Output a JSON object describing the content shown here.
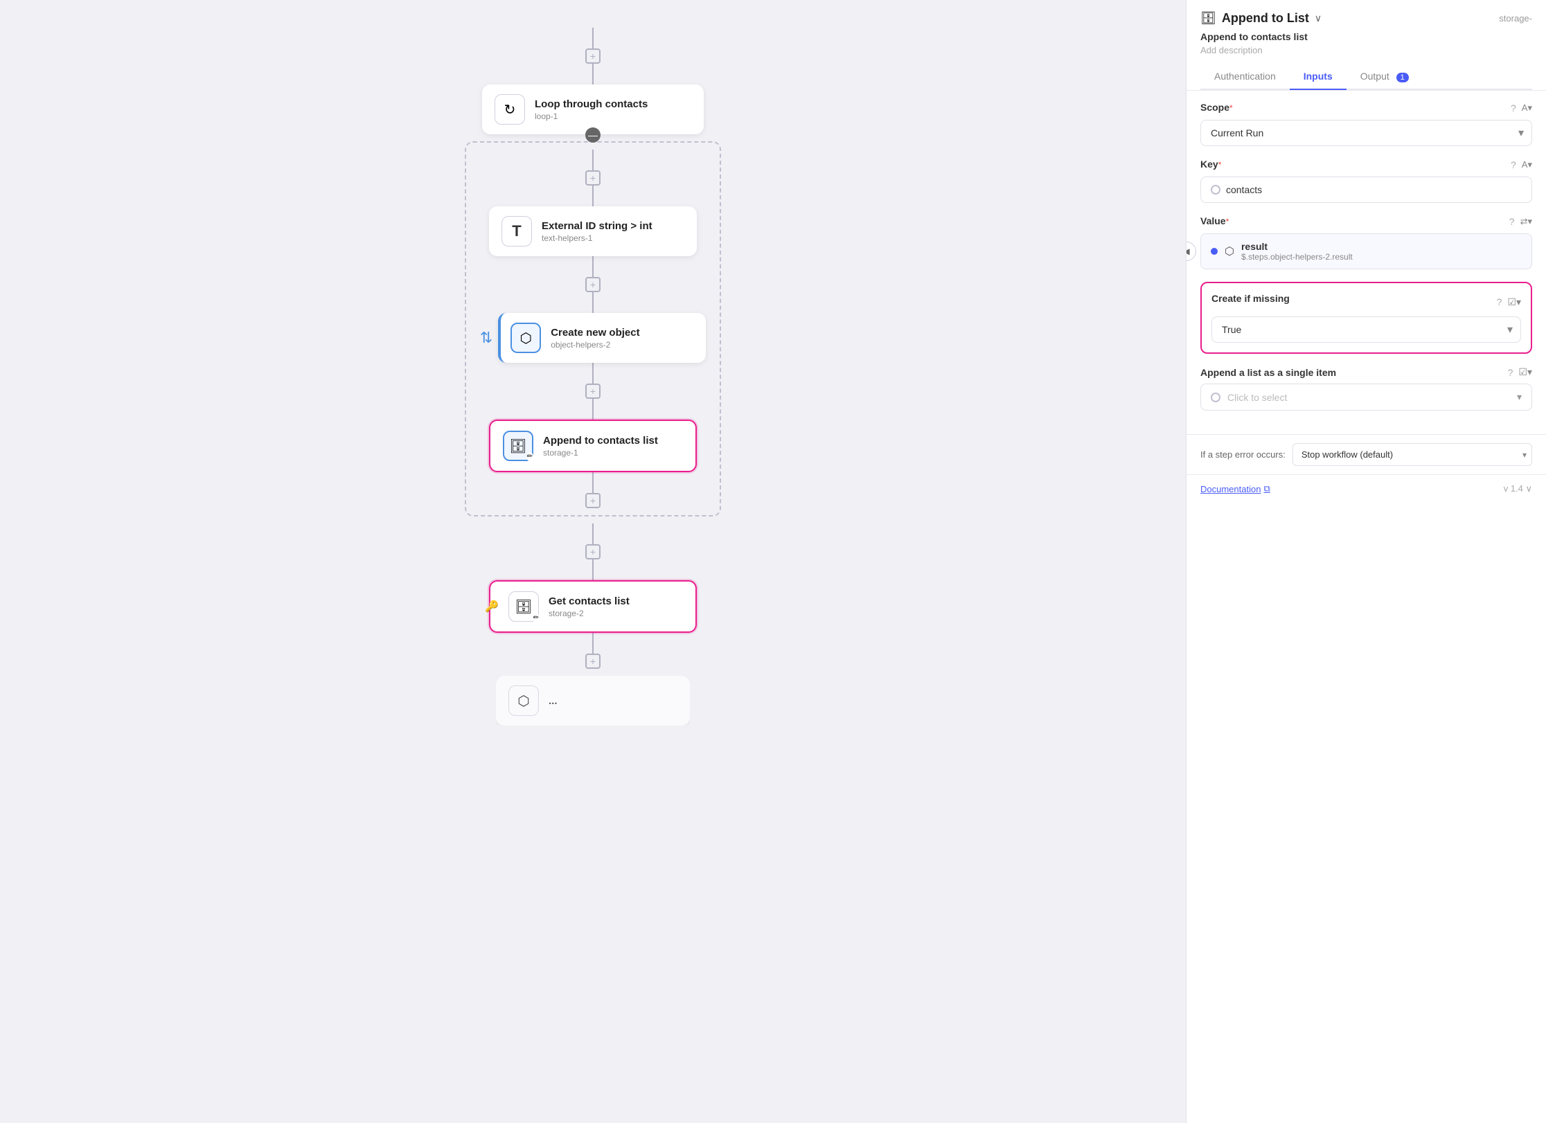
{
  "canvas": {
    "nodes": [
      {
        "id": "loop-1",
        "title": "Loop through contacts",
        "subtitle": "loop-1",
        "icon": "↻",
        "type": "loop"
      },
      {
        "id": "text-helpers-1",
        "title": "External ID string > int",
        "subtitle": "text-helpers-1",
        "icon": "T",
        "type": "text"
      },
      {
        "id": "object-helpers-2",
        "title": "Create new object",
        "subtitle": "object-helpers-2",
        "icon": "⬡",
        "type": "object",
        "hasLeftBar": true
      },
      {
        "id": "storage-1",
        "title": "Append to contacts list",
        "subtitle": "storage-1",
        "icon": "🗄",
        "type": "storage",
        "highlighted": true
      }
    ],
    "bottomNodes": [
      {
        "id": "storage-2",
        "title": "Get contacts list",
        "subtitle": "storage-2",
        "icon": "🗄",
        "type": "storage",
        "highlighted": true,
        "hasKey": true
      }
    ]
  },
  "panel": {
    "title": "Append to List",
    "chevron": "∨",
    "storage_badge": "storage-",
    "node_icon": "🗄",
    "description": "Append to contacts list",
    "add_description_placeholder": "Add description",
    "tabs": [
      {
        "label": "Authentication",
        "active": false,
        "badge": null
      },
      {
        "label": "Inputs",
        "active": true,
        "badge": null
      },
      {
        "label": "Output",
        "active": false,
        "badge": "1"
      }
    ],
    "fields": {
      "scope": {
        "label": "Scope",
        "required": true,
        "value": "Current Run"
      },
      "key": {
        "label": "Key",
        "required": true,
        "value": "contacts"
      },
      "value": {
        "label": "Value",
        "required": true,
        "item_name": "result",
        "item_path": "$.steps.object-helpers-2.result"
      },
      "create_if_missing": {
        "label": "Create if missing",
        "value": "True",
        "highlighted": true
      },
      "append_as_single": {
        "label": "Append a list as a single item",
        "placeholder": "Click to select"
      }
    },
    "error_section": {
      "label": "If a step error occurs:",
      "value": "Stop workflow (default)"
    },
    "footer": {
      "doc_label": "Documentation",
      "doc_icon": "⧉",
      "version": "v 1.4 ∨"
    },
    "collapse_icon": "◀"
  }
}
